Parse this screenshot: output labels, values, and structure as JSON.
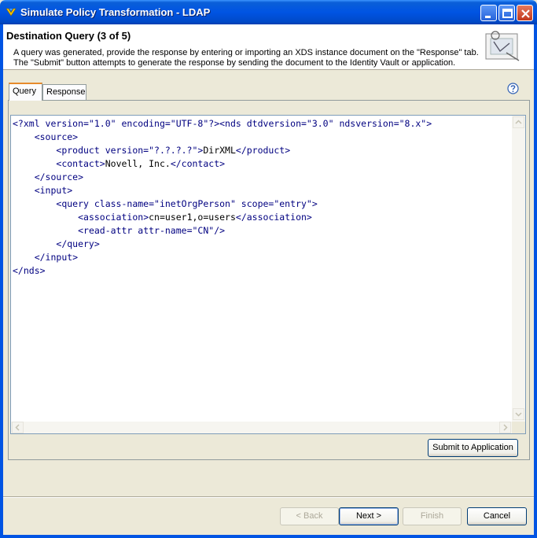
{
  "window": {
    "title": "Simulate Policy Transformation - LDAP"
  },
  "header": {
    "title": "Destination Query (3 of 5)",
    "description_line1": "A query was generated, provide the response by entering or importing an XDS instance document on the \"Response\" tab.",
    "description_line2": "The \"Submit\" button attempts to generate the response by sending the document to the Identity Vault or application."
  },
  "tabs": [
    {
      "label": "Query",
      "active": true
    },
    {
      "label": "Response",
      "active": false
    }
  ],
  "editor": {
    "lines": [
      "<?xml version=\"1.0\" encoding=\"UTF-8\"?><nds dtdversion=\"3.0\" ndsversion=\"8.x\">",
      "    <source>",
      "        <product version=\"?.?.?.?\">DirXML</product>",
      "        <contact>Novell, Inc.</contact>",
      "    </source>",
      "    <input>",
      "        <query class-name=\"inetOrgPerson\" scope=\"entry\">",
      "            <association>cn=user1,o=users</association>",
      "            <read-attr attr-name=\"CN\"/>",
      "        </query>",
      "    </input>",
      "</nds>"
    ]
  },
  "buttons": {
    "submit": "Submit to Application",
    "back": "< Back",
    "next": "Next >",
    "finish": "Finish",
    "cancel": "Cancel"
  },
  "colors": {
    "titlebar": "#0054e3",
    "tag": "#000080",
    "attribute": "#008000",
    "value": "#808000"
  }
}
